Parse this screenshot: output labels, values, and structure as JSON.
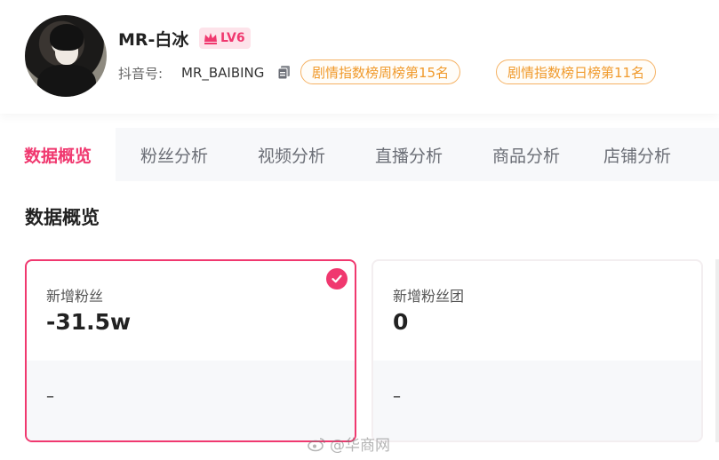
{
  "profile": {
    "name": "MR-白冰",
    "level": "LV6",
    "douyin_label": "抖音号:",
    "douyin_id": "MR_BAIBING",
    "rank_tags": [
      "剧情指数榜周榜第15名",
      "剧情指数榜日榜第11名"
    ]
  },
  "tabs": [
    "数据概览",
    "粉丝分析",
    "视频分析",
    "直播分析",
    "商品分析",
    "店铺分析"
  ],
  "section_title": "数据概览",
  "cards": [
    {
      "label": "新增粉丝",
      "value": "-31.5w",
      "sub": "–"
    },
    {
      "label": "新增粉丝团",
      "value": "0",
      "sub": "–"
    }
  ],
  "watermark": "@华商网",
  "colors": {
    "accent": "#f0386f",
    "rank_tag": "#f09a2c",
    "tab_bg": "#f7f8fa"
  },
  "icons": {
    "level": "crown-icon",
    "copy": "copy-icon",
    "selected": "check-icon",
    "watermark": "weibo-icon"
  }
}
